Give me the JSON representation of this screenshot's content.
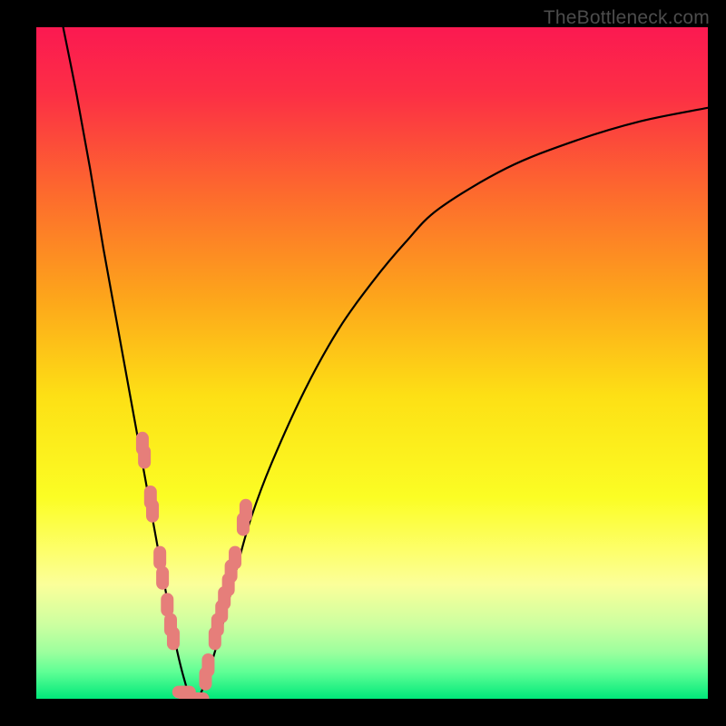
{
  "watermark": "TheBottleneck.com",
  "colors": {
    "frame": "#000000",
    "curve": "#000000",
    "marker": "#e67e7a",
    "gradient_stops": [
      {
        "offset": 0.0,
        "color": "#fb1951"
      },
      {
        "offset": 0.1,
        "color": "#fc2f45"
      },
      {
        "offset": 0.25,
        "color": "#fd6b2d"
      },
      {
        "offset": 0.4,
        "color": "#fda41b"
      },
      {
        "offset": 0.55,
        "color": "#fde015"
      },
      {
        "offset": 0.7,
        "color": "#fbfd24"
      },
      {
        "offset": 0.78,
        "color": "#fdff6b"
      },
      {
        "offset": 0.83,
        "color": "#fbff9a"
      },
      {
        "offset": 0.89,
        "color": "#ccffa0"
      },
      {
        "offset": 0.93,
        "color": "#9dff9e"
      },
      {
        "offset": 0.96,
        "color": "#5fff95"
      },
      {
        "offset": 1.0,
        "color": "#00e87a"
      }
    ]
  },
  "chart_data": {
    "type": "line",
    "title": "",
    "xlabel": "",
    "ylabel": "",
    "xlim": [
      0,
      100
    ],
    "ylim": [
      0,
      100
    ],
    "grid": false,
    "legend": false,
    "note": "Bottleneck-style V curve; minimum (0%) near x≈23. Y axis is inverted visually (0 at bottom = green). Values estimated from pixels.",
    "series": [
      {
        "name": "curve",
        "x": [
          4,
          6,
          8,
          10,
          12,
          14,
          16,
          18,
          20,
          21,
          22,
          23,
          24,
          25,
          26,
          28,
          30,
          32,
          35,
          40,
          45,
          50,
          55,
          60,
          70,
          80,
          90,
          100
        ],
        "y": [
          100,
          90,
          79,
          67,
          56,
          45,
          34,
          23,
          12,
          7,
          3,
          0,
          0,
          2,
          5,
          12,
          20,
          27,
          35,
          46,
          55,
          62,
          68,
          73,
          79,
          83,
          86,
          88
        ]
      }
    ],
    "markers": {
      "name": "highlighted-points",
      "color": "#e67e7a",
      "note": "Pink clustered markers along the curve near the minimum",
      "x": [
        15.8,
        16.1,
        17.0,
        17.3,
        18.4,
        18.8,
        19.5,
        20.0,
        20.4,
        22.0,
        23.0,
        24.0,
        25.2,
        25.6,
        26.6,
        27.0,
        27.6,
        28.0,
        28.6,
        29.0,
        29.6,
        30.8,
        31.2
      ],
      "y": [
        38,
        36,
        30,
        28,
        21,
        18,
        14,
        11,
        9,
        1,
        0,
        0,
        3,
        5,
        9,
        11,
        13,
        15,
        17,
        19,
        21,
        26,
        28
      ]
    }
  }
}
